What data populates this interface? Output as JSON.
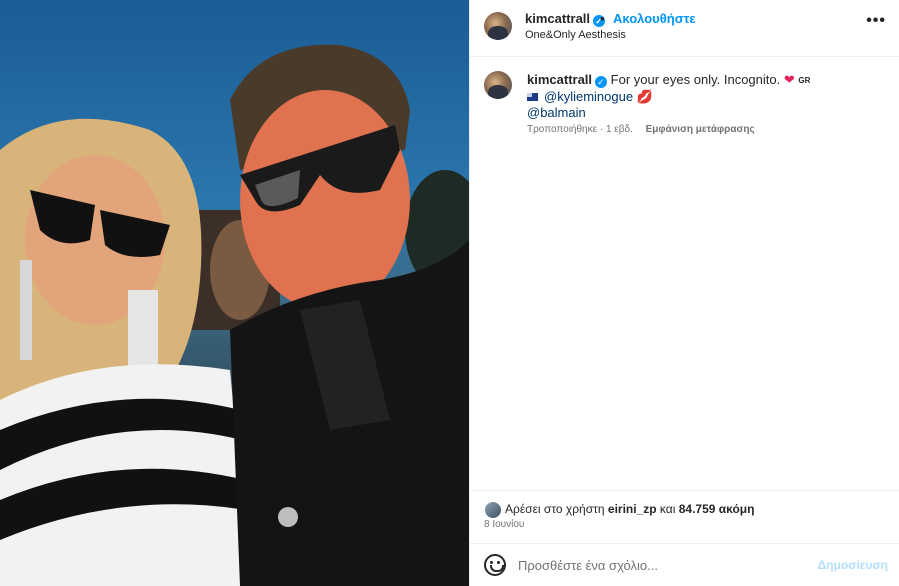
{
  "post": {
    "username": "kimcattrall",
    "follow_label": "Ακολουθήστε",
    "dot": "•",
    "location": "One&Only Aesthesis",
    "more_label": "•••"
  },
  "caption": {
    "username": "kimcattrall",
    "text": "For your eyes only. Incognito.",
    "heart": "❤",
    "gr": "GR",
    "mention1": "@kylieminogue",
    "kiss": "💋",
    "mention2": "@balmain",
    "edited": "Τροποποιήθηκε · 1 εβδ.",
    "translate": "Εμφάνιση μετάφρασης"
  },
  "likes": {
    "prefix": "Αρέσει στο χρήστη",
    "user": "eirini_zp",
    "connector": "και",
    "count": "84.759 ακόμη",
    "date": "8 Ιουνίου"
  },
  "comment": {
    "placeholder": "Προσθέστε ένα σχόλιο...",
    "post_label": "Δημοσίευση"
  },
  "icons": {
    "verified": "verified-check-icon",
    "emoji": "emoji-smiley-icon",
    "more": "more-options-icon"
  },
  "colors": {
    "accent": "#0095f6",
    "link": "#00376b",
    "muted": "#737373",
    "post_disabled": "#b2dffc"
  }
}
